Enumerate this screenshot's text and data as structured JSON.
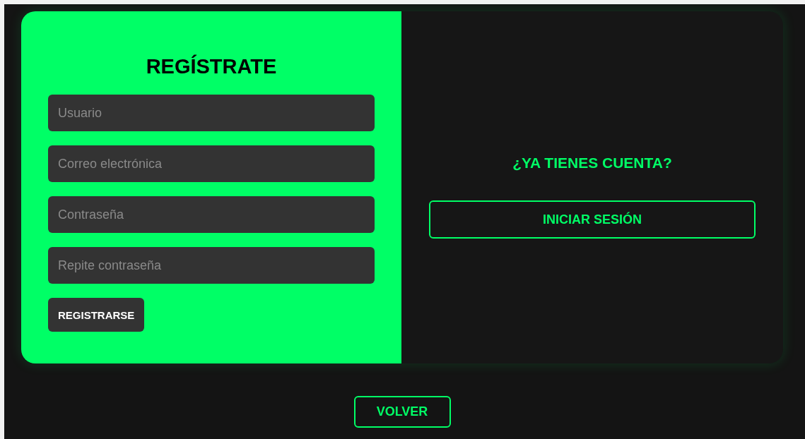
{
  "register": {
    "title": "REGÍSTRATE",
    "fields": [
      {
        "placeholder": "Usuario"
      },
      {
        "placeholder": "Correo electrónica"
      },
      {
        "placeholder": "Contraseña"
      },
      {
        "placeholder": "Repite contraseña"
      }
    ],
    "button": "REGISTRARSE"
  },
  "login": {
    "question": "¿YA TIENES CUENTA?",
    "button": "INICIAR SESIÓN"
  },
  "back_button": "VOLVER"
}
